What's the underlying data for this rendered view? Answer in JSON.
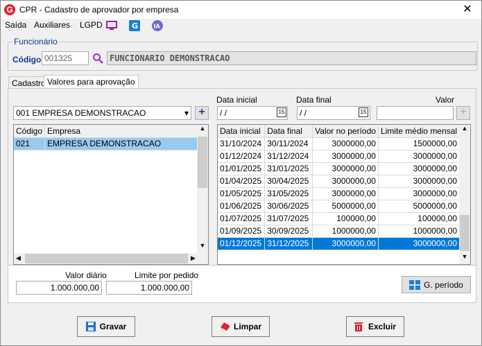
{
  "window": {
    "title": "CPR - Cadastro de aprovador por empresa",
    "close": "✕"
  },
  "menu": {
    "items": [
      "Saída",
      "Auxiliares",
      "LGPD"
    ]
  },
  "funcionario": {
    "legend": "Funcionário",
    "codigo_label": "Código",
    "codigo_value": "001325",
    "nome": "FUNCIONARIO DEMONSTRACAO"
  },
  "tabs": [
    "Cadastro",
    "Valores para aprovação"
  ],
  "empresa_select": "001 EMPRESA DEMONSTRACAO",
  "empresa_grid": {
    "headers": [
      "Código",
      "Empresa"
    ],
    "rows": [
      [
        "021",
        "EMPRESA DEMONSTRACAO"
      ]
    ]
  },
  "filters": {
    "data_inicial_label": "Data inicial",
    "data_inicial_value": " /  /",
    "data_final_label": "Data final",
    "data_final_value": " /  /",
    "valor_label": "Valor",
    "valor_value": "",
    "cal_icon": "15"
  },
  "periods_grid": {
    "headers": [
      "Data inicial",
      "Data final",
      "Valor no período",
      "Limite médio mensal"
    ],
    "rows": [
      [
        "31/10/2024",
        "30/11/2024",
        "3000000,00",
        "1500000,00"
      ],
      [
        "01/12/2024",
        "31/12/2024",
        "3000000,00",
        "3000000,00"
      ],
      [
        "01/01/2025",
        "31/01/2025",
        "3000000,00",
        "3000000,00"
      ],
      [
        "01/04/2025",
        "30/04/2025",
        "3000000,00",
        "3000000,00"
      ],
      [
        "01/05/2025",
        "31/05/2025",
        "3000000,00",
        "3000000,00"
      ],
      [
        "01/06/2025",
        "30/06/2025",
        "5000000,00",
        "5000000,00"
      ],
      [
        "01/07/2025",
        "31/07/2025",
        "100000,00",
        "100000,00"
      ],
      [
        "01/09/2025",
        "30/09/2025",
        "1000000,00",
        "1000000,00"
      ],
      [
        "01/12/2025",
        "31/12/2025",
        "3000000,00",
        "3000000,00"
      ]
    ]
  },
  "totals": {
    "valor_diario_label": "Valor diário",
    "valor_diario": "1.000.000,00",
    "limite_label": "Limite por pedido",
    "limite": "1.000.000,00"
  },
  "buttons": {
    "g_periodo": "G. período",
    "gravar": "Gravar",
    "limpar": "Limpar",
    "excluir": "Excluir"
  }
}
